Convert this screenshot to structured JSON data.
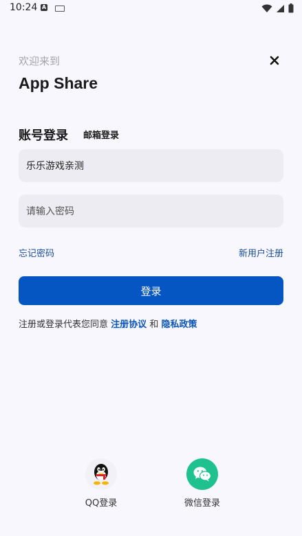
{
  "status_bar": {
    "time": "10:24"
  },
  "header": {
    "welcome_text": "欢迎来到",
    "app_title": "App Share",
    "close_icon": "close-icon"
  },
  "tabs": {
    "account_login": "账号登录",
    "email_login": "邮箱登录"
  },
  "form": {
    "username_value": "乐乐游戏亲测",
    "password_placeholder": "请输入密码"
  },
  "links": {
    "forgot_password": "忘记密码",
    "new_user_register": "新用户注册"
  },
  "login_button": "登录",
  "agreement": {
    "prefix": "注册或登录代表您同意",
    "terms": "注册协议",
    "and": "和",
    "privacy": "隐私政策"
  },
  "social": {
    "qq_label": "QQ登录",
    "wechat_label": "微信登录"
  },
  "colors": {
    "primary": "#0555c2",
    "link": "#1b4d99",
    "wechat": "#1fc18e",
    "background": "#f7f7fd"
  }
}
